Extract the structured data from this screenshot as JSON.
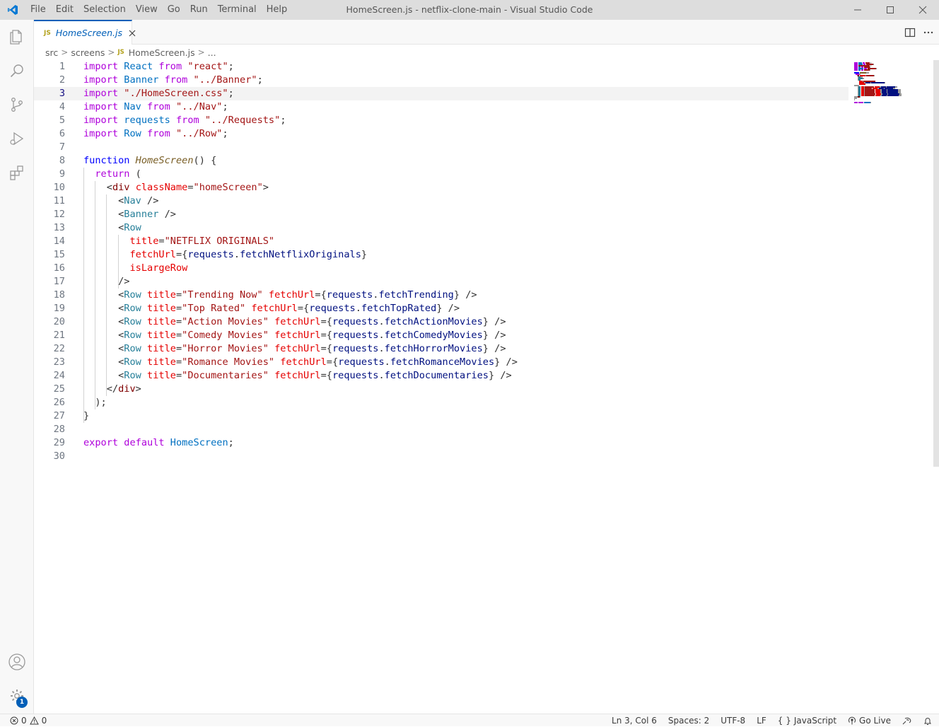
{
  "window": {
    "title": "HomeScreen.js - netflix-clone-main - Visual Studio Code",
    "accent_color": "#005fb8"
  },
  "menu": [
    "File",
    "Edit",
    "Selection",
    "View",
    "Go",
    "Run",
    "Terminal",
    "Help"
  ],
  "activity_bar": {
    "items": [
      "files-icon",
      "search-icon",
      "source-control-icon",
      "run-debug-icon",
      "extensions-icon"
    ],
    "bottom": [
      "account-icon",
      "manage-gear-icon"
    ],
    "manage_badge": "1"
  },
  "tabs": [
    {
      "label": "HomeScreen.js",
      "icon_text": "JS",
      "active": true
    }
  ],
  "breadcrumb": {
    "parts": [
      "src",
      "screens",
      "HomeScreen.js",
      "..."
    ],
    "file_icon_text": "JS"
  },
  "editor": {
    "current_line": 3,
    "lines": [
      {
        "n": "1"
      },
      {
        "n": "2"
      },
      {
        "n": "3"
      },
      {
        "n": "4"
      },
      {
        "n": "5"
      },
      {
        "n": "6"
      },
      {
        "n": "7"
      },
      {
        "n": "8"
      },
      {
        "n": "9"
      },
      {
        "n": "10"
      },
      {
        "n": "11"
      },
      {
        "n": "12"
      },
      {
        "n": "13"
      },
      {
        "n": "14"
      },
      {
        "n": "15"
      },
      {
        "n": "16"
      },
      {
        "n": "17"
      },
      {
        "n": "18"
      },
      {
        "n": "19"
      },
      {
        "n": "20"
      },
      {
        "n": "21"
      },
      {
        "n": "22"
      },
      {
        "n": "23"
      },
      {
        "n": "24"
      },
      {
        "n": "25"
      },
      {
        "n": "26"
      },
      {
        "n": "27"
      },
      {
        "n": "28"
      },
      {
        "n": "29"
      },
      {
        "n": "30"
      }
    ],
    "code": [
      [
        [
          "k",
          "import"
        ],
        [
          "p",
          " "
        ],
        [
          "v",
          "React"
        ],
        [
          "p",
          " "
        ],
        [
          "k",
          "from"
        ],
        [
          "p",
          " "
        ],
        [
          "s",
          "\"react\""
        ],
        [
          "p",
          ";"
        ]
      ],
      [
        [
          "k",
          "import"
        ],
        [
          "p",
          " "
        ],
        [
          "v",
          "Banner"
        ],
        [
          "p",
          " "
        ],
        [
          "k",
          "from"
        ],
        [
          "p",
          " "
        ],
        [
          "s",
          "\"../Banner\""
        ],
        [
          "p",
          ";"
        ]
      ],
      [
        [
          "k",
          "import"
        ],
        [
          "p",
          " "
        ],
        [
          "s",
          "\"./HomeScreen.css\""
        ],
        [
          "p",
          ";"
        ]
      ],
      [
        [
          "k",
          "import"
        ],
        [
          "p",
          " "
        ],
        [
          "v",
          "Nav"
        ],
        [
          "p",
          " "
        ],
        [
          "k",
          "from"
        ],
        [
          "p",
          " "
        ],
        [
          "s",
          "\"../Nav\""
        ],
        [
          "p",
          ";"
        ]
      ],
      [
        [
          "k",
          "import"
        ],
        [
          "p",
          " "
        ],
        [
          "v",
          "requests"
        ],
        [
          "p",
          " "
        ],
        [
          "k",
          "from"
        ],
        [
          "p",
          " "
        ],
        [
          "s",
          "\"../Requests\""
        ],
        [
          "p",
          ";"
        ]
      ],
      [
        [
          "k",
          "import"
        ],
        [
          "p",
          " "
        ],
        [
          "v",
          "Row"
        ],
        [
          "p",
          " "
        ],
        [
          "k",
          "from"
        ],
        [
          "p",
          " "
        ],
        [
          "s",
          "\"../Row\""
        ],
        [
          "p",
          ";"
        ]
      ],
      [],
      [
        [
          "kb",
          "function"
        ],
        [
          "p",
          " "
        ],
        [
          "f",
          "HomeScreen"
        ],
        [
          "p",
          "() {"
        ]
      ],
      [
        [
          "p",
          "  "
        ],
        [
          "k",
          "return"
        ],
        [
          "p",
          " ("
        ]
      ],
      [
        [
          "p",
          "    "
        ],
        [
          "p",
          "<"
        ],
        [
          "t",
          "div"
        ],
        [
          "p",
          " "
        ],
        [
          "a",
          "className"
        ],
        [
          "p",
          "="
        ],
        [
          "s",
          "\"homeScreen\""
        ],
        [
          "p",
          ">"
        ]
      ],
      [
        [
          "p",
          "      "
        ],
        [
          "p",
          "<"
        ],
        [
          "fn",
          "Nav"
        ],
        [
          "p",
          " />"
        ]
      ],
      [
        [
          "p",
          "      "
        ],
        [
          "p",
          "<"
        ],
        [
          "fn",
          "Banner"
        ],
        [
          "p",
          " />"
        ]
      ],
      [
        [
          "p",
          "      "
        ],
        [
          "p",
          "<"
        ],
        [
          "fn",
          "Row"
        ]
      ],
      [
        [
          "p",
          "        "
        ],
        [
          "a",
          "title"
        ],
        [
          "p",
          "="
        ],
        [
          "s",
          "\"NETFLIX ORIGINALS\""
        ]
      ],
      [
        [
          "p",
          "        "
        ],
        [
          "a",
          "fetchUrl"
        ],
        [
          "p",
          "={"
        ],
        [
          "pr",
          "requests"
        ],
        [
          "p",
          "."
        ],
        [
          "pr",
          "fetchNetflixOriginals"
        ],
        [
          "p",
          "}"
        ]
      ],
      [
        [
          "p",
          "        "
        ],
        [
          "a",
          "isLargeRow"
        ]
      ],
      [
        [
          "p",
          "      />"
        ]
      ],
      [
        [
          "p",
          "      "
        ],
        [
          "p",
          "<"
        ],
        [
          "fn",
          "Row"
        ],
        [
          "p",
          " "
        ],
        [
          "a",
          "title"
        ],
        [
          "p",
          "="
        ],
        [
          "s",
          "\"Trending Now\""
        ],
        [
          "p",
          " "
        ],
        [
          "a",
          "fetchUrl"
        ],
        [
          "p",
          "={"
        ],
        [
          "pr",
          "requests"
        ],
        [
          "p",
          "."
        ],
        [
          "pr",
          "fetchTrending"
        ],
        [
          "p",
          "} />"
        ]
      ],
      [
        [
          "p",
          "      "
        ],
        [
          "p",
          "<"
        ],
        [
          "fn",
          "Row"
        ],
        [
          "p",
          " "
        ],
        [
          "a",
          "title"
        ],
        [
          "p",
          "="
        ],
        [
          "s",
          "\"Top Rated\""
        ],
        [
          "p",
          " "
        ],
        [
          "a",
          "fetchUrl"
        ],
        [
          "p",
          "={"
        ],
        [
          "pr",
          "requests"
        ],
        [
          "p",
          "."
        ],
        [
          "pr",
          "fetchTopRated"
        ],
        [
          "p",
          "} />"
        ]
      ],
      [
        [
          "p",
          "      "
        ],
        [
          "p",
          "<"
        ],
        [
          "fn",
          "Row"
        ],
        [
          "p",
          " "
        ],
        [
          "a",
          "title"
        ],
        [
          "p",
          "="
        ],
        [
          "s",
          "\"Action Movies\""
        ],
        [
          "p",
          " "
        ],
        [
          "a",
          "fetchUrl"
        ],
        [
          "p",
          "={"
        ],
        [
          "pr",
          "requests"
        ],
        [
          "p",
          "."
        ],
        [
          "pr",
          "fetchActionMovies"
        ],
        [
          "p",
          "} />"
        ]
      ],
      [
        [
          "p",
          "      "
        ],
        [
          "p",
          "<"
        ],
        [
          "fn",
          "Row"
        ],
        [
          "p",
          " "
        ],
        [
          "a",
          "title"
        ],
        [
          "p",
          "="
        ],
        [
          "s",
          "\"Comedy Movies\""
        ],
        [
          "p",
          " "
        ],
        [
          "a",
          "fetchUrl"
        ],
        [
          "p",
          "={"
        ],
        [
          "pr",
          "requests"
        ],
        [
          "p",
          "."
        ],
        [
          "pr",
          "fetchComedyMovies"
        ],
        [
          "p",
          "} />"
        ]
      ],
      [
        [
          "p",
          "      "
        ],
        [
          "p",
          "<"
        ],
        [
          "fn",
          "Row"
        ],
        [
          "p",
          " "
        ],
        [
          "a",
          "title"
        ],
        [
          "p",
          "="
        ],
        [
          "s",
          "\"Horror Movies\""
        ],
        [
          "p",
          " "
        ],
        [
          "a",
          "fetchUrl"
        ],
        [
          "p",
          "={"
        ],
        [
          "pr",
          "requests"
        ],
        [
          "p",
          "."
        ],
        [
          "pr",
          "fetchHorrorMovies"
        ],
        [
          "p",
          "} />"
        ]
      ],
      [
        [
          "p",
          "      "
        ],
        [
          "p",
          "<"
        ],
        [
          "fn",
          "Row"
        ],
        [
          "p",
          " "
        ],
        [
          "a",
          "title"
        ],
        [
          "p",
          "="
        ],
        [
          "s",
          "\"Romance Movies\""
        ],
        [
          "p",
          " "
        ],
        [
          "a",
          "fetchUrl"
        ],
        [
          "p",
          "={"
        ],
        [
          "pr",
          "requests"
        ],
        [
          "p",
          "."
        ],
        [
          "pr",
          "fetchRomanceMovies"
        ],
        [
          "p",
          "} />"
        ]
      ],
      [
        [
          "p",
          "      "
        ],
        [
          "p",
          "<"
        ],
        [
          "fn",
          "Row"
        ],
        [
          "p",
          " "
        ],
        [
          "a",
          "title"
        ],
        [
          "p",
          "="
        ],
        [
          "s",
          "\"Documentaries\""
        ],
        [
          "p",
          " "
        ],
        [
          "a",
          "fetchUrl"
        ],
        [
          "p",
          "={"
        ],
        [
          "pr",
          "requests"
        ],
        [
          "p",
          "."
        ],
        [
          "pr",
          "fetchDocumentaries"
        ],
        [
          "p",
          "} />"
        ]
      ],
      [
        [
          "p",
          "    </"
        ],
        [
          "t",
          "div"
        ],
        [
          "p",
          ">"
        ]
      ],
      [
        [
          "p",
          "  );"
        ]
      ],
      [
        [
          "p",
          "}"
        ]
      ],
      [],
      [
        [
          "k",
          "export"
        ],
        [
          "p",
          " "
        ],
        [
          "k",
          "default"
        ],
        [
          "p",
          " "
        ],
        [
          "v",
          "HomeScreen"
        ],
        [
          "p",
          ";"
        ]
      ],
      []
    ]
  },
  "statusbar": {
    "errors": "0",
    "warnings": "0",
    "position": "Ln 3, Col 6",
    "spaces": "Spaces: 2",
    "encoding": "UTF-8",
    "eol": "LF",
    "language": "JavaScript",
    "go_live": "Go Live"
  }
}
